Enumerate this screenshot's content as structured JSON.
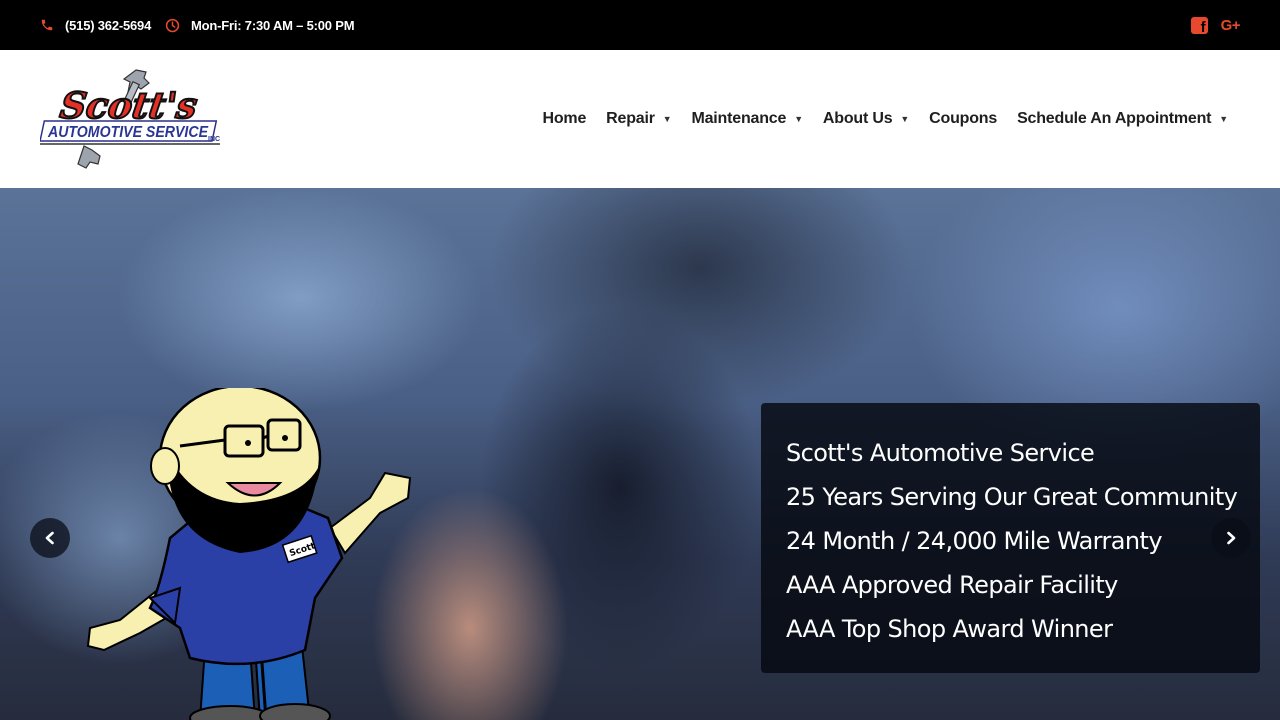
{
  "topbar": {
    "phone": "(515) 362-5694",
    "hours": "Mon-Fri: 7:30 AM – 5:00 PM",
    "accent_color": "#e8492e",
    "icons": [
      "phone-icon",
      "clock-icon",
      "facebook-icon",
      "google-plus-icon"
    ]
  },
  "logo": {
    "line1": "Scott's",
    "line2": "AUTOMOTIVE SERVICE",
    "suffix": "INC"
  },
  "nav": {
    "items": [
      {
        "label": "Home",
        "has_dropdown": false
      },
      {
        "label": "Repair",
        "has_dropdown": true
      },
      {
        "label": "Maintenance",
        "has_dropdown": true
      },
      {
        "label": "About Us",
        "has_dropdown": true
      },
      {
        "label": "Coupons",
        "has_dropdown": false
      },
      {
        "label": "Schedule An Appointment",
        "has_dropdown": true
      }
    ]
  },
  "hero": {
    "mascot_badge": "Scott",
    "captions": [
      "Scott's Automotive Service",
      "25 Years Serving Our Great Community",
      "24 Month / 24,000 Mile Warranty",
      "AAA Approved Repair Facility",
      "AAA Top Shop Award Winner"
    ]
  }
}
